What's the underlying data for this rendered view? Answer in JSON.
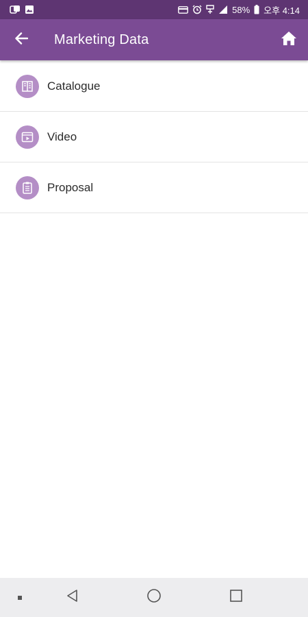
{
  "status_bar": {
    "battery": "58%",
    "time": "오후 4:14",
    "left_icons": [
      "office-icon",
      "gallery-icon"
    ],
    "right_icons": [
      "card-icon",
      "alarm-icon",
      "signal-label-icon",
      "signal-icon",
      "battery-icon"
    ]
  },
  "app_bar": {
    "title": "Marketing Data",
    "background": "#7b4b94",
    "status_background": "#5e3572"
  },
  "items": [
    {
      "label": "Catalogue",
      "icon": "book-icon"
    },
    {
      "label": "Video",
      "icon": "video-icon"
    },
    {
      "label": "Proposal",
      "icon": "clipboard-icon"
    }
  ],
  "accent_icon_bg": "#b48ec6",
  "nav_bar": {
    "buttons": [
      "recent-dot-icon",
      "back-triangle-icon",
      "home-circle-icon",
      "overview-square-icon"
    ]
  }
}
